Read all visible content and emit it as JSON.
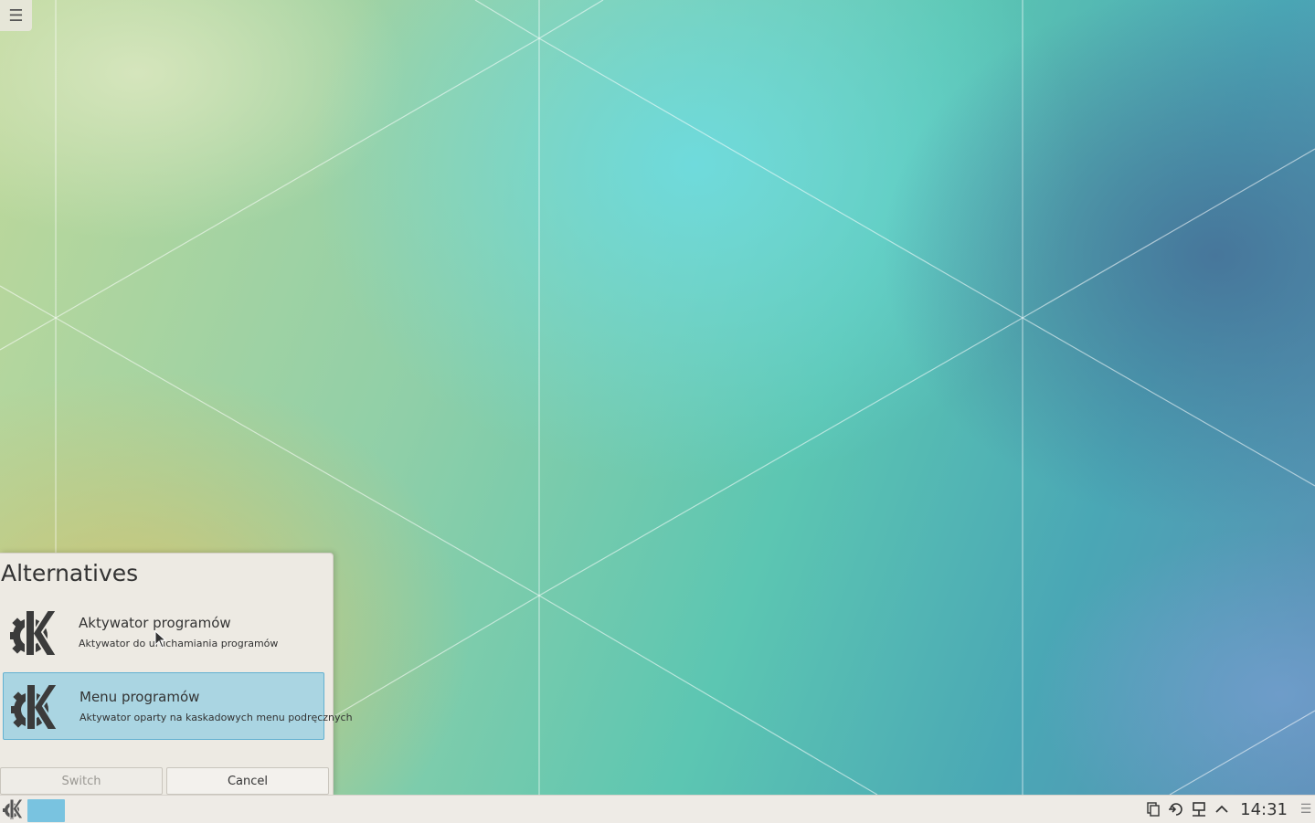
{
  "desktop": {
    "toolbox_icon": "hamburger-icon"
  },
  "dialog": {
    "title": "Alternatives",
    "items": [
      {
        "name": "Aktywator programów",
        "description": "Aktywator do uruchamiania programów",
        "icon": "kde-logo-icon",
        "selected": false
      },
      {
        "name": "Menu programów",
        "description": "Aktywator oparty na kaskadowych menu podręcznych",
        "icon": "kde-logo-icon",
        "selected": true
      }
    ],
    "buttons": {
      "switch_label": "Switch",
      "cancel_label": "Cancel"
    }
  },
  "panel": {
    "launcher_icon": "kde-logo-icon",
    "task_color": "#79c3e0",
    "tray_icons": [
      "clipboard-icon",
      "device-notifier-icon",
      "network-icon",
      "expand-arrow-icon"
    ],
    "clock": "14:31",
    "menu_icon": "hamburger-icon"
  },
  "colors": {
    "selection": "#aad5e2",
    "selection_border": "#63b1d1",
    "panel": "#eeebe6"
  }
}
